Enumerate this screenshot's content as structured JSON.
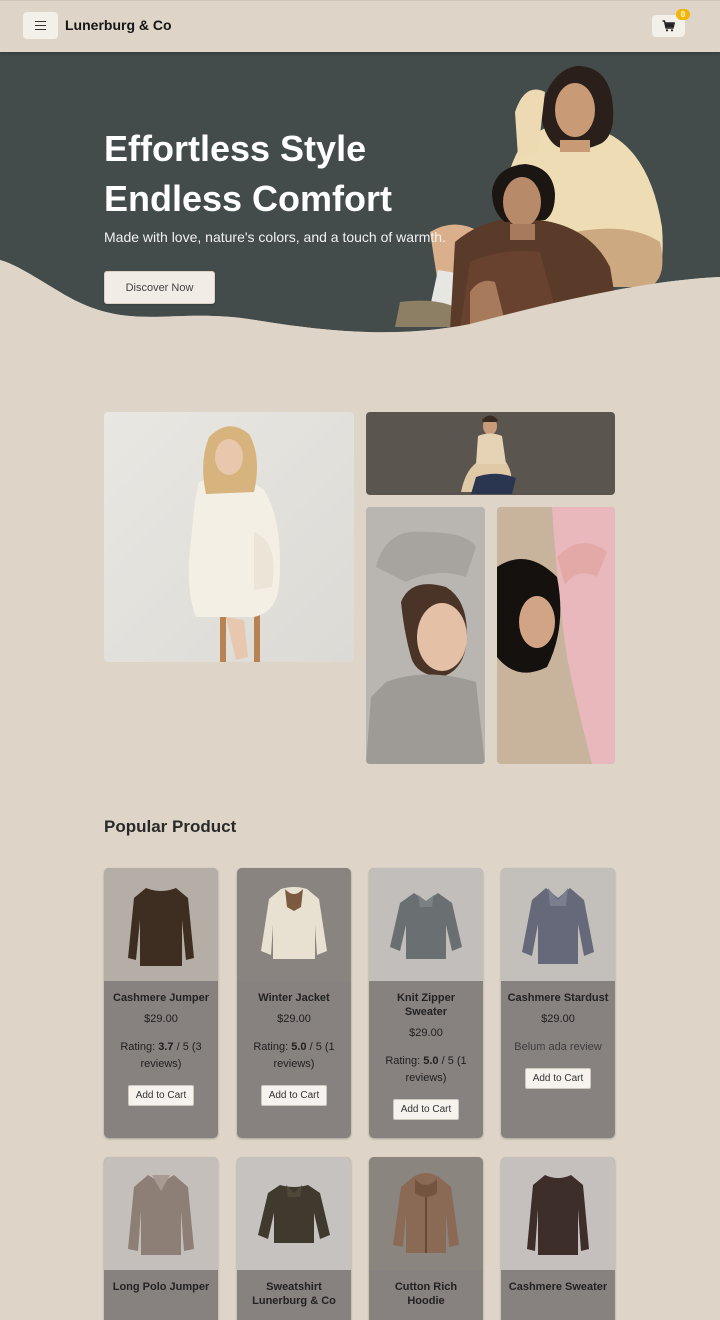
{
  "navbar": {
    "menu_icon": "hamburger-icon",
    "brand": "Lunerburg & Co",
    "cart_icon": "shopping-cart-icon",
    "cart_count": "0"
  },
  "hero": {
    "title_line1": "Effortless Style",
    "title_line2": "Endless Comfort",
    "subtitle": "Made with love, nature's colors, and a touch of warmth.",
    "cta": "Discover Now"
  },
  "popular": {
    "title": "Popular Product",
    "products": [
      {
        "name": "Cashmere Jumper",
        "price": "$29.00",
        "rating_label": "Rating:",
        "score": "3.7",
        "rating_rest": "/ 5 (3 reviews)",
        "add": "Add to Cart"
      },
      {
        "name": "Winter Jacket",
        "price": "$29.00",
        "rating_label": "Rating:",
        "score": "5.0",
        "rating_rest": "/ 5 (1 reviews)",
        "add": "Add to Cart"
      },
      {
        "name": "Knit Zipper Sweater",
        "price": "$29.00",
        "rating_label": "Rating:",
        "score": "5.0",
        "rating_rest": "/ 5 (1 reviews)",
        "add": "Add to Cart"
      },
      {
        "name": "Cashmere Stardust",
        "price": "$29.00",
        "no_review": "Belum ada review",
        "add": "Add to Cart"
      },
      {
        "name": "Long Polo Jumper"
      },
      {
        "name": "Sweatshirt Lunerburg & Co"
      },
      {
        "name": "Cutton Rich Hoodie"
      },
      {
        "name": "Cashmere Sweater"
      }
    ]
  },
  "colors": {
    "background": "#ded5c8",
    "hero_dark": "#434b4b",
    "card": "#878280",
    "badge": "#f4b400"
  }
}
